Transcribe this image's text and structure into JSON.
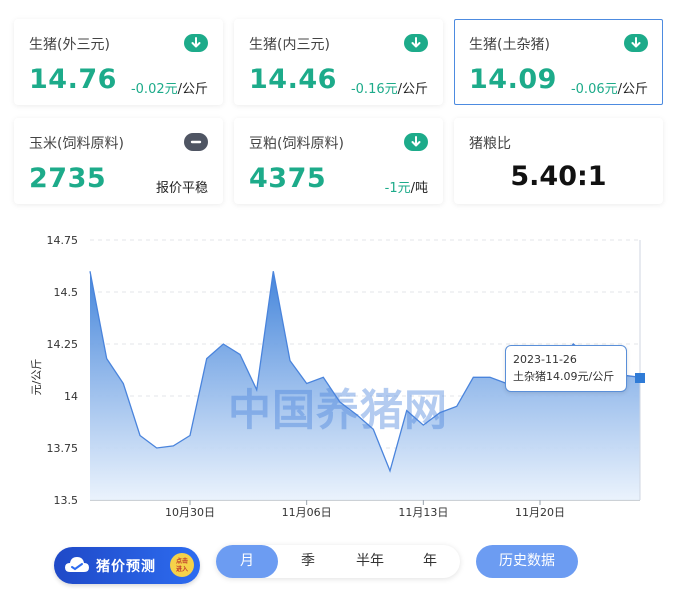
{
  "cards": [
    {
      "name": "生猪(外三元)",
      "price": "14.76",
      "change": "-0.02元",
      "unit": "/公斤",
      "trend": "down"
    },
    {
      "name": "生猪(内三元)",
      "price": "14.46",
      "change": "-0.16元",
      "unit": "/公斤",
      "trend": "down"
    },
    {
      "name": "生猪(土杂猪)",
      "price": "14.09",
      "change": "-0.06元",
      "unit": "/公斤",
      "trend": "down",
      "active": true
    },
    {
      "name": "玉米(饲料原料)",
      "price": "2735",
      "change": "报价平稳",
      "unit": "",
      "trend": "flat"
    },
    {
      "name": "豆粕(饲料原料)",
      "price": "4375",
      "change": "-1元",
      "unit": "/吨",
      "trend": "down"
    },
    {
      "name": "猪粮比",
      "value": "5.40:1"
    }
  ],
  "chart_data": {
    "type": "area",
    "ylabel": "元/公斤",
    "ylim": [
      13.5,
      14.75
    ],
    "yticks": [
      "14.75",
      "14.5",
      "14.25",
      "14",
      "13.75",
      "13.5"
    ],
    "xtick_labels": [
      "10月30日",
      "11月06日",
      "11月13日",
      "11月20日"
    ],
    "xtick_index": [
      6,
      13,
      20,
      27
    ],
    "x": [
      "10-24",
      "10-25",
      "10-26",
      "10-27",
      "10-28",
      "10-29",
      "10-30",
      "10-31",
      "11-01",
      "11-02",
      "11-03",
      "11-04",
      "11-05",
      "11-06",
      "11-07",
      "11-08",
      "11-09",
      "11-10",
      "11-11",
      "11-12",
      "11-13",
      "11-14",
      "11-15",
      "11-16",
      "11-17",
      "11-18",
      "11-19",
      "11-20",
      "11-21",
      "11-22",
      "11-23",
      "11-24",
      "11-25",
      "11-26"
    ],
    "values": [
      14.6,
      14.18,
      14.06,
      13.81,
      13.75,
      13.76,
      13.81,
      14.18,
      14.25,
      14.2,
      14.03,
      14.6,
      14.17,
      14.06,
      14.09,
      13.97,
      13.91,
      13.84,
      13.64,
      13.93,
      13.86,
      13.92,
      13.95,
      14.09,
      14.09,
      14.06,
      14.12,
      14.12,
      14.14,
      14.25,
      14.18,
      14.18,
      14.1,
      14.09
    ],
    "colors": {
      "line": "#4a84dc",
      "fill_top": "#3b7fd9",
      "fill_bottom": "#e8f1fc"
    }
  },
  "tooltip": {
    "date": "2023-11-26",
    "text": "土杂猪14.09元/公斤"
  },
  "watermark": "中国养猪网",
  "promo": {
    "label": "猪价预测",
    "go_top": "点击",
    "go_bottom": "进入"
  },
  "periods": [
    "月",
    "季",
    "半年",
    "年"
  ],
  "selected_period": "月",
  "history_button": "历史数据"
}
